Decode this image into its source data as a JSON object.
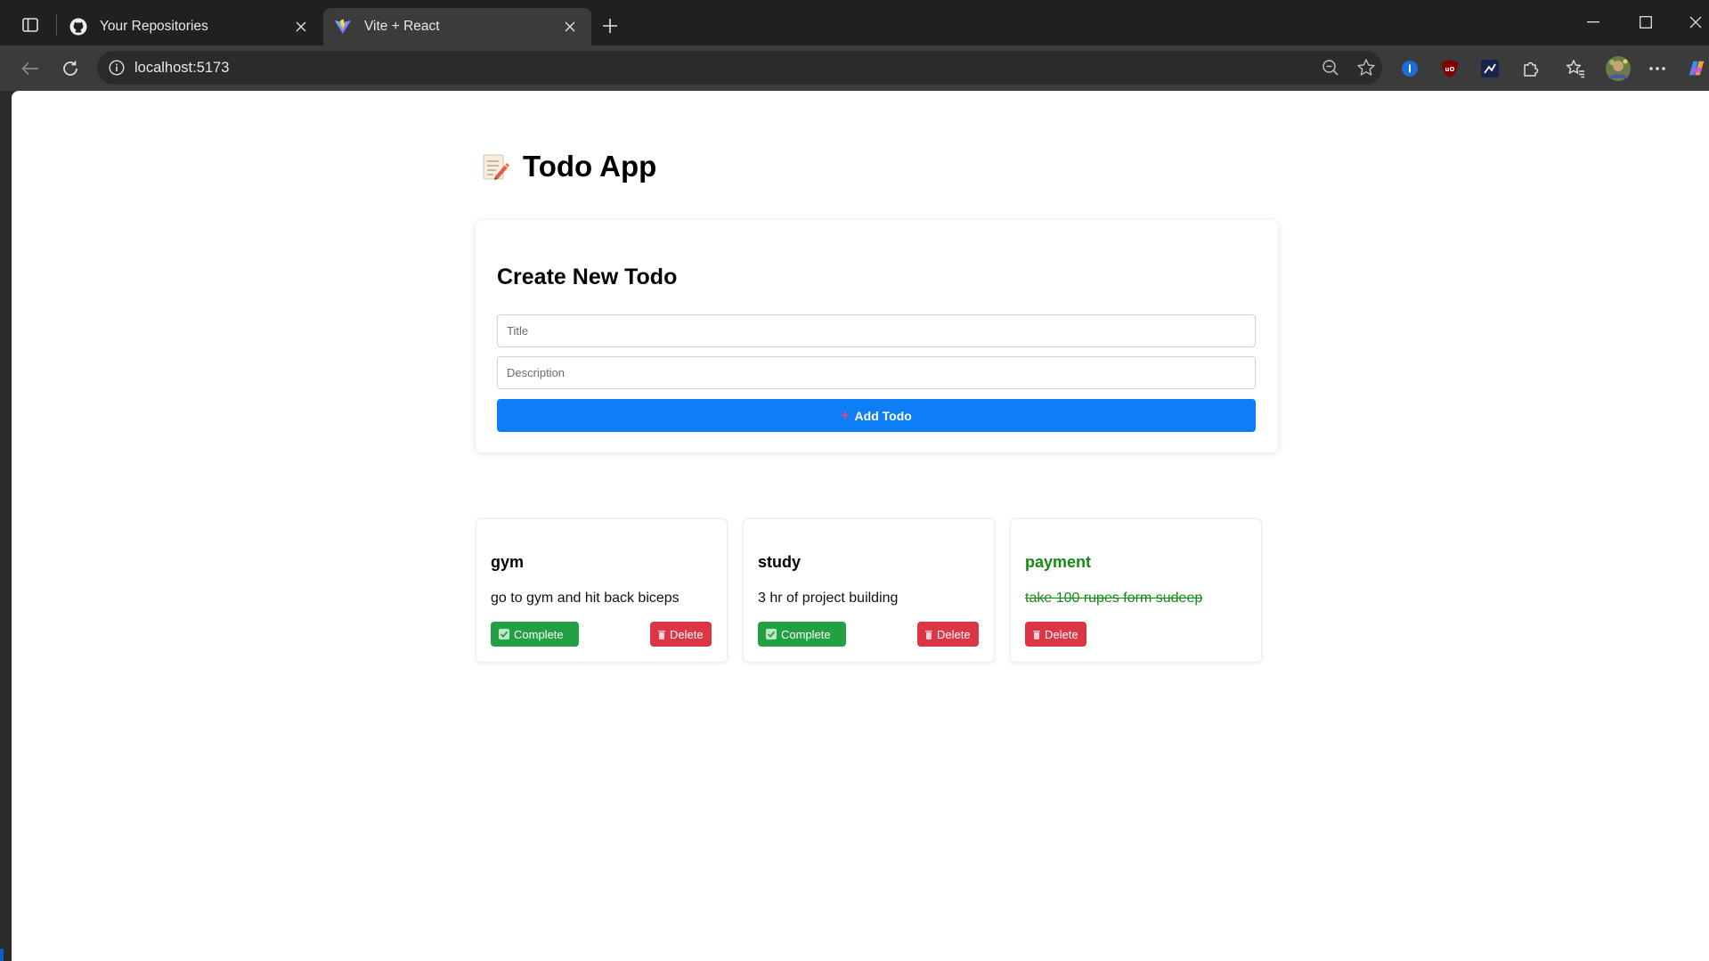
{
  "browser": {
    "tabs": [
      {
        "label": "Your Repositories",
        "favicon": "github-icon",
        "active": false
      },
      {
        "label": "Vite + React",
        "favicon": "vite-icon",
        "active": true
      }
    ],
    "address": "localhost:5173"
  },
  "app": {
    "title": "Todo App",
    "title_icon": "memo-icon",
    "create": {
      "heading": "Create New Todo",
      "title_placeholder": "Title",
      "description_placeholder": "Description",
      "add_label": "Add Todo",
      "add_icon": "plus-icon"
    },
    "todos": [
      {
        "title": "gym",
        "description": "go to gym and hit back biceps",
        "completed": false,
        "complete_label": "Complete",
        "delete_label": "Delete"
      },
      {
        "title": "study",
        "description": "3 hr of project building",
        "completed": false,
        "complete_label": "Complete",
        "delete_label": "Delete"
      },
      {
        "title": "payment",
        "description": "take 100 rupes form sudeep",
        "completed": true,
        "delete_label": "Delete"
      }
    ]
  },
  "colors": {
    "primary": "#0d7ef5",
    "complete": "#23a043",
    "delete": "#dc3545",
    "done_text": "#138a13"
  }
}
